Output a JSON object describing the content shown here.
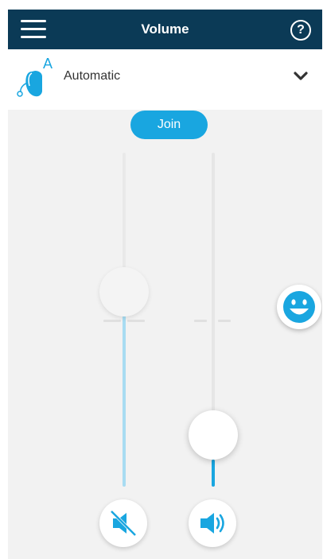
{
  "header": {
    "title": "Volume",
    "menu_icon": "hamburger-menu-icon",
    "help_icon": "help-icon",
    "help_symbol": "?"
  },
  "program_selector": {
    "label": "Automatic",
    "icon": "hearing-aid-automatic-icon",
    "icon_letter": "A",
    "dropdown_icon": "chevron-down-icon"
  },
  "join_button": {
    "label": "Join"
  },
  "sliders": [
    {
      "name": "left",
      "level": 0.47,
      "active": false
    },
    {
      "name": "right",
      "level": 0.12,
      "active": true
    }
  ],
  "buttons": {
    "mute_icon": "speaker-muted-icon",
    "volume_icon": "speaker-volume-icon",
    "feedback_icon": "smiley-face-icon"
  },
  "colors": {
    "header_bg": "#0b3a56",
    "accent": "#19a6e0",
    "accent_light": "#a8dcf2",
    "background": "#f2f2f2"
  }
}
